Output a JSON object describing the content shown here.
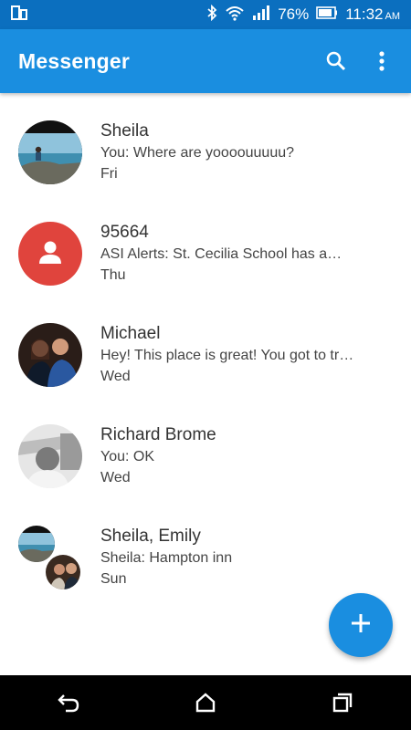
{
  "status_bar": {
    "battery_percent": "76%",
    "time": "11:32",
    "ampm": "AM",
    "icons": [
      "screen-icon",
      "bluetooth-icon",
      "wifi-icon",
      "signal-icon",
      "battery-icon"
    ]
  },
  "app_bar": {
    "title": "Messenger",
    "icons": [
      "search-icon",
      "more-vert-icon"
    ]
  },
  "conversations": [
    {
      "name": "Sheila",
      "snippet": "You: Where are yoooouuuuu?",
      "date": "Fri"
    },
    {
      "name": "95664",
      "snippet": "ASI Alerts: St. Cecilia School has a…",
      "date": "Thu"
    },
    {
      "name": "Michael",
      "snippet": "Hey! This place is great! You got to tr…",
      "date": "Wed"
    },
    {
      "name": "Richard Brome",
      "snippet": "You: OK",
      "date": "Wed"
    },
    {
      "name": "Sheila, Emily",
      "snippet": "Sheila: Hampton inn",
      "date": "Sun"
    }
  ],
  "colors": {
    "status_bar": "#0b6fbf",
    "app_bar": "#1a8ee0",
    "default_avatar": "#e0443d",
    "fab": "#1a8ee0"
  },
  "fab": {
    "icon": "plus-icon"
  },
  "nav_bar": {
    "icons": [
      "back-icon",
      "home-icon",
      "recents-icon"
    ]
  }
}
